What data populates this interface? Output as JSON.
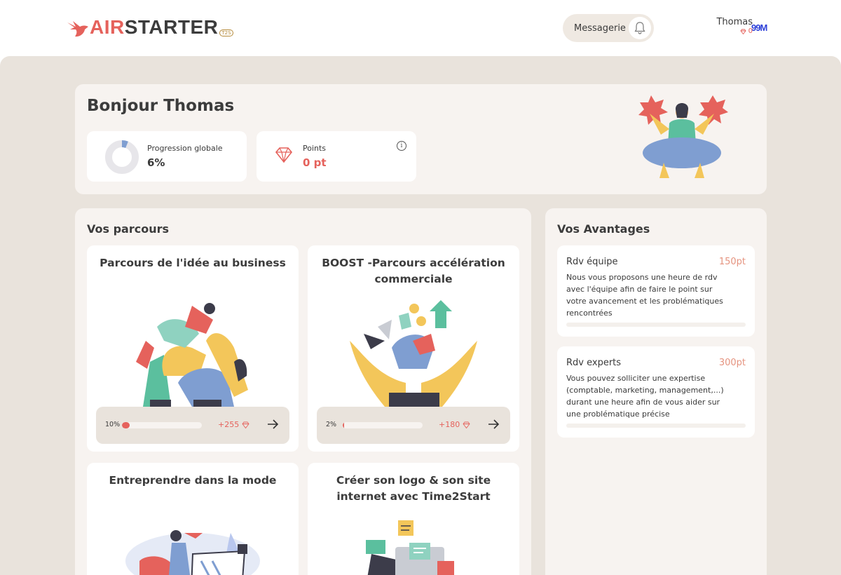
{
  "header": {
    "logo": {
      "part1": "AIR",
      "part2": "STARTER",
      "suffix": "T2S"
    },
    "messagerie_label": "Messagerie",
    "user": {
      "name": "Thomas",
      "points": "0"
    },
    "brand_badge": "99M"
  },
  "welcome": {
    "greeting": "Bonjour Thomas",
    "progress": {
      "label": "Progression globale",
      "value": "6%",
      "fraction": 0.06
    },
    "points": {
      "label": "Points",
      "value": "0 pt"
    }
  },
  "parcours": {
    "title": "Vos parcours",
    "items": [
      {
        "title": "Parcours de l'idée au business",
        "percent_label": "10%",
        "percent": 10,
        "gain": "+255"
      },
      {
        "title": "BOOST -Parcours accélération commerciale",
        "percent_label": "2%",
        "percent": 2,
        "gain": "+180"
      },
      {
        "title": "Entreprendre dans la mode"
      },
      {
        "title": "Créer son logo & son site internet avec Time2Start"
      }
    ]
  },
  "avantages": {
    "title": "Vos Avantages",
    "items": [
      {
        "title": "Rdv équipe",
        "cost": "150pt",
        "description": "Nous vous proposons une heure de rdv avec l'équipe afin de faire le point sur votre avancement et les problématiques rencontrées"
      },
      {
        "title": "Rdv experts",
        "cost": "300pt",
        "description": "Vous pouvez solliciter une expertise (comptable, marketing, management,...) durant une heure afin de vous aider sur une problématique précise"
      }
    ]
  },
  "colors": {
    "accent": "#e5625c",
    "background": "#e9e3dc",
    "card": "#f7f3f0",
    "progress_ring": "#7f9ed1"
  },
  "icons": [
    "bird-logo-icon",
    "bell-icon",
    "gem-icon",
    "info-icon",
    "arrow-right-icon"
  ]
}
